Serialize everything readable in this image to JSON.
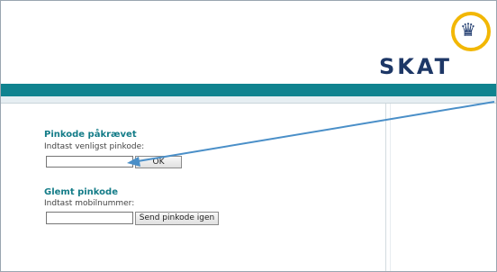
{
  "header": {
    "brand": "SKAT",
    "logo_icon": "crown-icon"
  },
  "pin_section": {
    "heading": "Pinkode påkrævet",
    "label": "Indtast venligst pinkode:",
    "input_value": "",
    "ok_label": "OK"
  },
  "forgot_section": {
    "heading": "Glemt pinkode",
    "label": "Indtast mobilnummer:",
    "input_value": "",
    "send_label": "Send pinkode igen"
  },
  "colors": {
    "accent": "#10838f",
    "heading": "#147c88",
    "brand": "#1d3766",
    "logo_ring": "#f2b705",
    "arrow": "#4a8fc8"
  }
}
